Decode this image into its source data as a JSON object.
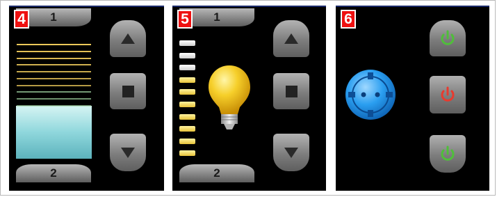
{
  "panels": [
    {
      "id": "4",
      "badge": "4",
      "top_label": "1",
      "bottom_label": "2",
      "controls": [
        "arrow-up-icon",
        "stop-square-icon",
        "arrow-down-icon"
      ],
      "blind_closed_fraction": 0.57
    },
    {
      "id": "5",
      "badge": "5",
      "top_label": "1",
      "bottom_label": "2",
      "controls": [
        "arrow-up-icon",
        "stop-square-icon",
        "arrow-down-icon"
      ],
      "dimmer_levels_total": 10,
      "dimmer_levels_on": 7
    },
    {
      "id": "6",
      "badge": "6",
      "socket_icon": "power-socket-icon",
      "power_buttons": [
        {
          "icon": "power-icon",
          "color": "#4fbf3a"
        },
        {
          "icon": "power-icon",
          "color": "#e83a2e"
        },
        {
          "icon": "power-icon",
          "color": "#4fbf3a"
        }
      ]
    }
  ],
  "colors": {
    "badge": "#ee1111",
    "slat_yellow": "#ecc85a",
    "slat_green": "#9fd3a0",
    "window_glass": "#8fd7dc",
    "led_on": "#f3d25a",
    "led_off": "#e9e9e9",
    "bulb": "#f4c21b",
    "socket_blue": "#1e8fe6",
    "power_green": "#4fbf3a",
    "power_red": "#e83a2e"
  }
}
